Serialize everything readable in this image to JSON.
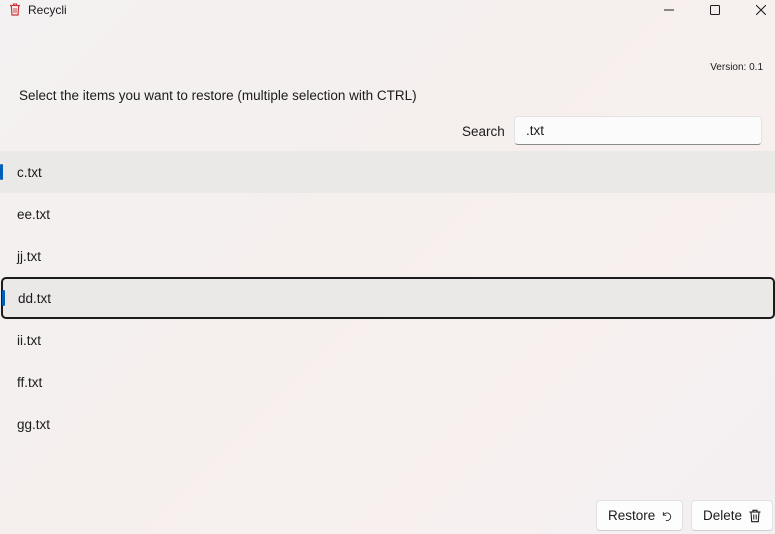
{
  "window": {
    "title": "Recycli",
    "icon": "recycle-bin-icon",
    "controls": [
      "minimize-icon",
      "maximize-icon",
      "close-icon"
    ]
  },
  "version_text": "Version: 0.1",
  "instructions": "Select the items you want to restore (multiple selection with CTRL)",
  "search": {
    "label": "Search",
    "value": ".txt"
  },
  "items": [
    {
      "name": "c.txt",
      "selected": true,
      "focused": false
    },
    {
      "name": "ee.txt",
      "selected": false,
      "focused": false
    },
    {
      "name": "jj.txt",
      "selected": false,
      "focused": false
    },
    {
      "name": "dd.txt",
      "selected": true,
      "focused": true
    },
    {
      "name": "ii.txt",
      "selected": false,
      "focused": false
    },
    {
      "name": "ff.txt",
      "selected": false,
      "focused": false
    },
    {
      "name": "gg.txt",
      "selected": false,
      "focused": false
    }
  ],
  "buttons": {
    "restore": {
      "label": "Restore",
      "icon": "undo-icon"
    },
    "delete": {
      "label": "Delete",
      "icon": "trash-icon"
    }
  },
  "colors": {
    "accent": "#005fb8",
    "app_icon": "#d13438"
  }
}
